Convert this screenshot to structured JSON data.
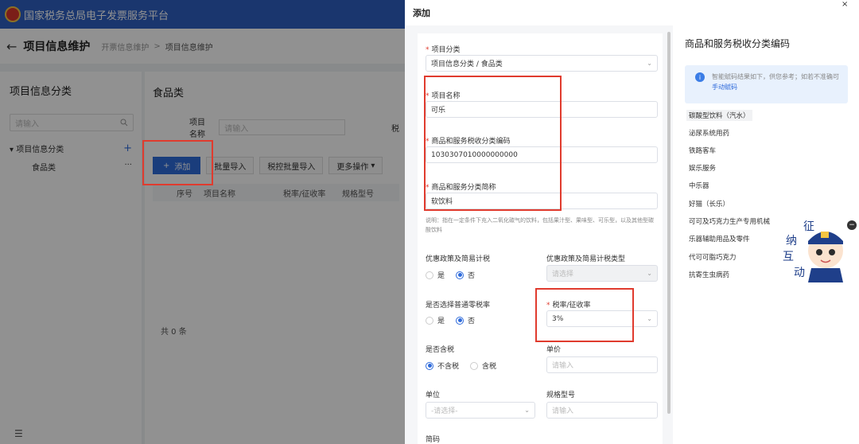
{
  "topbar": {
    "title": "国家税务总局电子发票服务平台"
  },
  "breadcrumb": {
    "title": "项目信息维护",
    "items": [
      "开票信息维护",
      ">",
      "项目信息维护"
    ]
  },
  "left_panel": {
    "title": "项目信息分类",
    "search_placeholder": "请输入",
    "tree_root": "项目信息分类",
    "tree_child": "食品类",
    "more": "···"
  },
  "right_panel": {
    "title": "食品类",
    "filter_label": "项目名称",
    "filter_placeholder": "请输入",
    "filter_cut": "税",
    "buttons": {
      "add": "添加",
      "batch_import": "批量导入",
      "tax_import": "税控批量导入",
      "more": "更多操作"
    },
    "table_headers": [
      "序号",
      "项目名称",
      "税率/征收率",
      "规格型号"
    ],
    "total": "共 0 条"
  },
  "drawer": {
    "title": "添加",
    "category": {
      "label": "项目分类",
      "value": "项目信息分类 / 食品类"
    },
    "name": {
      "label": "项目名称",
      "value": "可乐"
    },
    "code": {
      "label": "商品和服务税收分类编码",
      "value": "1030307010000000000"
    },
    "short_name": {
      "label": "商品和服务分类简称",
      "value": "软饮料"
    },
    "note": "说明：指在一定条件下充入二氧化碳气的饮料，包括果汁型、果味型、可乐型，以及其他型碳酸饮料",
    "preferential": {
      "label": "优惠政策及简易计税",
      "yes": "是",
      "no": "否"
    },
    "preferential_type": {
      "label": "优惠政策及简易计税类型",
      "placeholder": "请选择"
    },
    "zero_rate": {
      "label": "是否选择普通零税率",
      "yes": "是",
      "no": "否"
    },
    "tax_rate": {
      "label": "税率/征收率",
      "value": "3%"
    },
    "tax_included": {
      "label": "是否含税",
      "no": "不含税",
      "yes": "含税"
    },
    "unit_price": {
      "label": "单价",
      "placeholder": "请输入"
    },
    "unit": {
      "label": "单位",
      "placeholder": "-请选择-"
    },
    "spec": {
      "label": "规格型号",
      "placeholder": "请输入"
    },
    "short_code": {
      "label": "简码"
    }
  },
  "side": {
    "title": "商品和服务税收分类编码",
    "info_text": "智能赋码结果如下，供您参考；如若不准确可",
    "info_link": "手动赋码",
    "suggestions": [
      "碳酸型饮料（汽水）",
      "泌尿系统用药",
      "铁路客车",
      "娱乐服务",
      "中乐器",
      "好猫（长乐）",
      "可可及巧克力生产专用机械",
      "乐器辅助用品及零件",
      "代可可脂巧克力",
      "抗寄生虫病药"
    ]
  },
  "mascot": {
    "chars": [
      "征",
      "纳",
      "互",
      "动"
    ]
  },
  "colors": {
    "primary": "#2f6bdb",
    "header": "#2f5fc1",
    "highlight": "#e03b2e"
  }
}
